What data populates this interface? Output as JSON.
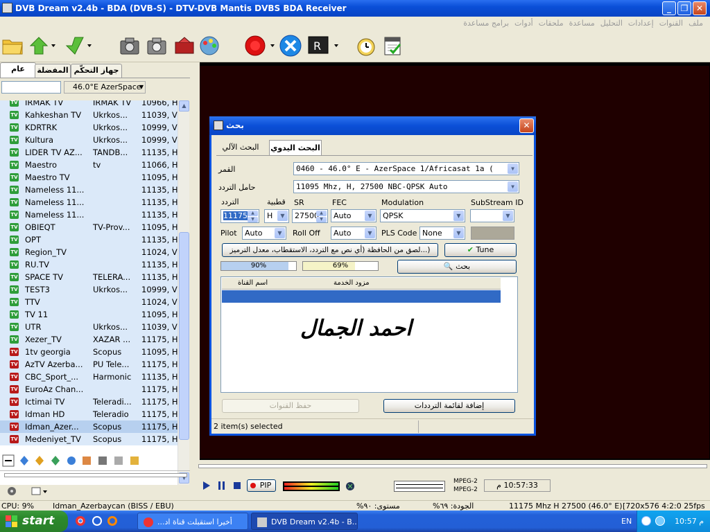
{
  "window": {
    "title": "DVB Dream v2.4b - BDA (DVB-S)  - DTV-DVB Mantis DVBS BDA Receiver"
  },
  "menu": [
    "ملف",
    "القنوات",
    "إعدادات",
    "التحليل",
    "مساعدة",
    "ملحقات",
    "أدوات",
    "برامج مساعدة"
  ],
  "left_tabs": [
    "عام",
    "المفضلة",
    "جهاز التحكّم"
  ],
  "satellite_filter": "46.0°E AzerSpace",
  "channels": [
    {
      "name": "IRMAK TV",
      "provider": "IRMAK TV",
      "freq": "10966, H",
      "type": "tv"
    },
    {
      "name": "Kahkeshan TV",
      "provider": "Ukrkos...",
      "freq": "11039, V",
      "type": "tv"
    },
    {
      "name": "KDRTRK",
      "provider": "Ukrkos...",
      "freq": "10999, V",
      "type": "tv"
    },
    {
      "name": "Kultura",
      "provider": "Ukrkos...",
      "freq": "10999, V",
      "type": "tv"
    },
    {
      "name": "LIDER TV AZ...",
      "provider": "TANDB...",
      "freq": "11135, H",
      "type": "tv"
    },
    {
      "name": "Maestro",
      "provider": "tv",
      "freq": "11066, H",
      "type": "tv"
    },
    {
      "name": "Maestro TV",
      "provider": "",
      "freq": "11095, H",
      "type": "tv"
    },
    {
      "name": "Nameless 11...",
      "provider": "",
      "freq": "11135, H",
      "type": "tv"
    },
    {
      "name": "Nameless 11...",
      "provider": "",
      "freq": "11135, H",
      "type": "tv"
    },
    {
      "name": "Nameless 11...",
      "provider": "",
      "freq": "11135, H",
      "type": "tv"
    },
    {
      "name": "OBIEQT",
      "provider": "TV-Prov...",
      "freq": "11095, H",
      "type": "tv"
    },
    {
      "name": "OPT",
      "provider": "",
      "freq": "11135, H",
      "type": "tv"
    },
    {
      "name": "Region_TV",
      "provider": "",
      "freq": "11024, V",
      "type": "tv"
    },
    {
      "name": "RU.TV",
      "provider": "",
      "freq": "11135, H",
      "type": "tv"
    },
    {
      "name": "SPACE TV",
      "provider": "TELERA...",
      "freq": "11135, H",
      "type": "tv"
    },
    {
      "name": "TEST3",
      "provider": "Ukrkos...",
      "freq": "10999, V",
      "type": "tv"
    },
    {
      "name": "TTV",
      "provider": "",
      "freq": "11024, V",
      "type": "tv"
    },
    {
      "name": "TV 11",
      "provider": "",
      "freq": "11095, H",
      "type": "tv"
    },
    {
      "name": "UTR",
      "provider": "Ukrkos...",
      "freq": "11039, V",
      "type": "tv"
    },
    {
      "name": "Xezer_TV",
      "provider": "XAZAR ...",
      "freq": "11175, H",
      "type": "tv"
    },
    {
      "name": "1tv georgia",
      "provider": "Scopus",
      "freq": "11095, H",
      "type": "tv-enc"
    },
    {
      "name": "AzTV Azerba...",
      "provider": "PU Tele...",
      "freq": "11175, H",
      "type": "tv-enc"
    },
    {
      "name": "CBC_Sport_...",
      "provider": "Harmonic",
      "freq": "11135, H",
      "type": "tv-enc"
    },
    {
      "name": "EuroAz Chan...",
      "provider": "",
      "freq": "11175, H",
      "type": "tv-enc"
    },
    {
      "name": "Ictimai TV",
      "provider": "Teleradi...",
      "freq": "11175, H",
      "type": "tv-enc"
    },
    {
      "name": "Idman HD",
      "provider": "Teleradio",
      "freq": "11175, H",
      "type": "tv-enc"
    },
    {
      "name": "Idman_Azer...",
      "provider": "Scopus",
      "freq": "11175, H",
      "type": "tv-enc",
      "selected": true
    },
    {
      "name": "Medeniyet_TV",
      "provider": "Scopus",
      "freq": "11175, H",
      "type": "tv-enc"
    }
  ],
  "icon_tv_text": "TV",
  "dialog": {
    "title": "بحث",
    "tabs": [
      "البحث الآلي",
      "البحث اليدوي"
    ],
    "sat_label": "القمر",
    "sat_value": "0460 - 46.0° E - AzerSpace 1/Africasat 1a (",
    "tp_label": "حامل التردد",
    "tp_value": "11095 Mhz, H, 27500   NBC-QPSK Auto",
    "freq_label": "التردد",
    "freq_value": "11175",
    "pol_label": "قطبية",
    "pol_value": "H",
    "sr_label": "SR",
    "sr_value": "27500",
    "fec_label": "FEC",
    "fec_value": "Auto",
    "mod_label": "Modulation",
    "mod_value": "QPSK",
    "substream_label": "SubStream ID",
    "substream_value": "",
    "pilot_label": "Pilot",
    "pilot_value": "Auto",
    "rolloff_label": "Roll Off",
    "rolloff_value": "Auto",
    "pls_label": "PLS Code",
    "pls_value": "None",
    "paste_button": "(...لصق من الحافظة (أي نص مع التردد، الاستقطاب، معدل الترميز",
    "tune_button": "Tune",
    "signal_text": "90%",
    "signal_level": 0.9,
    "quality_text": "69%",
    "quality_level": 0.69,
    "search_button": "بحث",
    "col_provider": "مزود الخدمة",
    "col_channel": "اسم القناة",
    "watermark": "احمد الجمال",
    "save_button": "حفظ القنوات",
    "add_button": "إضافة لقائمة الترددات",
    "status": "2 item(s) selected"
  },
  "player": {
    "pip_label": "PIP",
    "mpeg1": "MPEG-2",
    "mpeg2": "MPEG-2",
    "time": "10:57:33 م"
  },
  "statusbar": {
    "cpu": "CPU: 9%",
    "channel": "Idman_Azerbaycan (BISS / EBU)",
    "level": "مستوى: ٩٠%",
    "quality": "الجودة: ٦٩%",
    "tp": "11175 Mhz  H  27500  (46.0° E)",
    "video": "[720x576 4:2:0 25fps"
  },
  "taskbar": {
    "start": "start",
    "task1": "...أخيرا استقبلت قناة اد",
    "task2": "DVB Dream v2.4b - B...",
    "lang": "EN",
    "clock": "10:57 م"
  },
  "colors": {
    "accent": "#0a53df",
    "tv_icon": "#2e9d3a",
    "tv_enc_icon": "#b81a1a",
    "selection": "#316ac5"
  }
}
